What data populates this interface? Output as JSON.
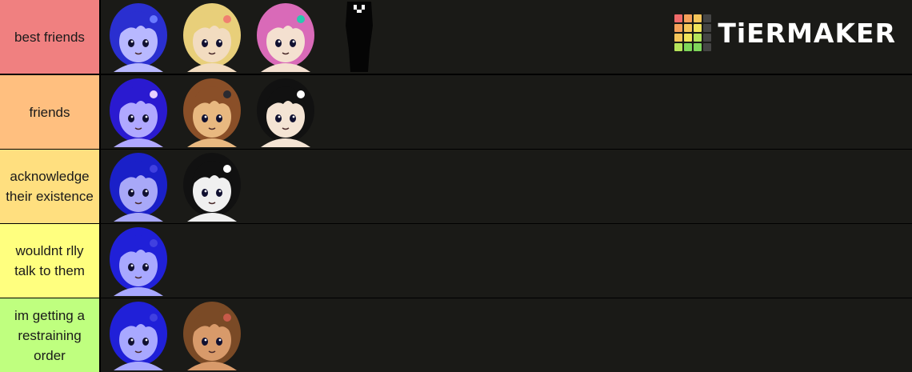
{
  "brand": {
    "name": "TiERMAKER"
  },
  "tiers": [
    {
      "label": "best friends",
      "color": "#f08080"
    },
    {
      "label": "friends",
      "color": "#ffbf7f"
    },
    {
      "label": "acknowledge their existence",
      "color": "#ffdf7f"
    },
    {
      "label": "wouldnt rlly talk to them",
      "color": "#ffff7f"
    },
    {
      "label": "im getting a restraining order",
      "color": "#bfff7f"
    }
  ],
  "logo_colors": [
    "#f06a6a",
    "#f5a05a",
    "#f5c55a",
    "#444444",
    "#f5a05a",
    "#f5c55a",
    "#f0e25a",
    "#444444",
    "#f5c55a",
    "#f0e25a",
    "#b5e35a",
    "#444444",
    "#b5e35a",
    "#7fd65a",
    "#7fd65a",
    "#444444"
  ],
  "items": {
    "tier0": [
      {
        "name": "flower-crown-blue-character",
        "hair": "#2a2fd0",
        "skin": "#b8b8ff",
        "accent": "#6a7aff"
      },
      {
        "name": "blonde-character",
        "hair": "#e8cf7a",
        "skin": "#f2dcc0",
        "accent": "#f08070"
      },
      {
        "name": "pink-hair-character",
        "hair": "#d96ab8",
        "skin": "#f4e0d0",
        "accent": "#27c9b0"
      },
      {
        "name": "shadow-silhouette-character",
        "hair": "#050505",
        "skin": "#050505",
        "accent": "#ffffff"
      }
    ],
    "tier1": [
      {
        "name": "blue-longhair-bow-character",
        "hair": "#2a1ad0",
        "skin": "#b0a8ff",
        "accent": "#e8d0ff"
      },
      {
        "name": "brown-hair-character",
        "hair": "#8a4f28",
        "skin": "#e8b880",
        "accent": "#2a2a30"
      },
      {
        "name": "black-hair-character",
        "hair": "#111111",
        "skin": "#f4e4d4",
        "accent": "#ffffff"
      }
    ],
    "tier2": [
      {
        "name": "blue-longhair-character",
        "hair": "#1a20c8",
        "skin": "#a8a8f8",
        "accent": "#4040e0"
      },
      {
        "name": "monochrome-character",
        "hair": "#111111",
        "skin": "#f0f0f0",
        "accent": "#ffffff"
      }
    ],
    "tier3": [
      {
        "name": "blue-spiky-hair-character",
        "hair": "#2020d8",
        "skin": "#a8a8ff",
        "accent": "#4040e0"
      }
    ],
    "tier4": [
      {
        "name": "blue-shorthair-character",
        "hair": "#2020d8",
        "skin": "#a8a8ff",
        "accent": "#4040e0"
      },
      {
        "name": "brown-bob-character",
        "hair": "#7a4a26",
        "skin": "#d89a6a",
        "accent": "#c85a4a"
      }
    ]
  }
}
